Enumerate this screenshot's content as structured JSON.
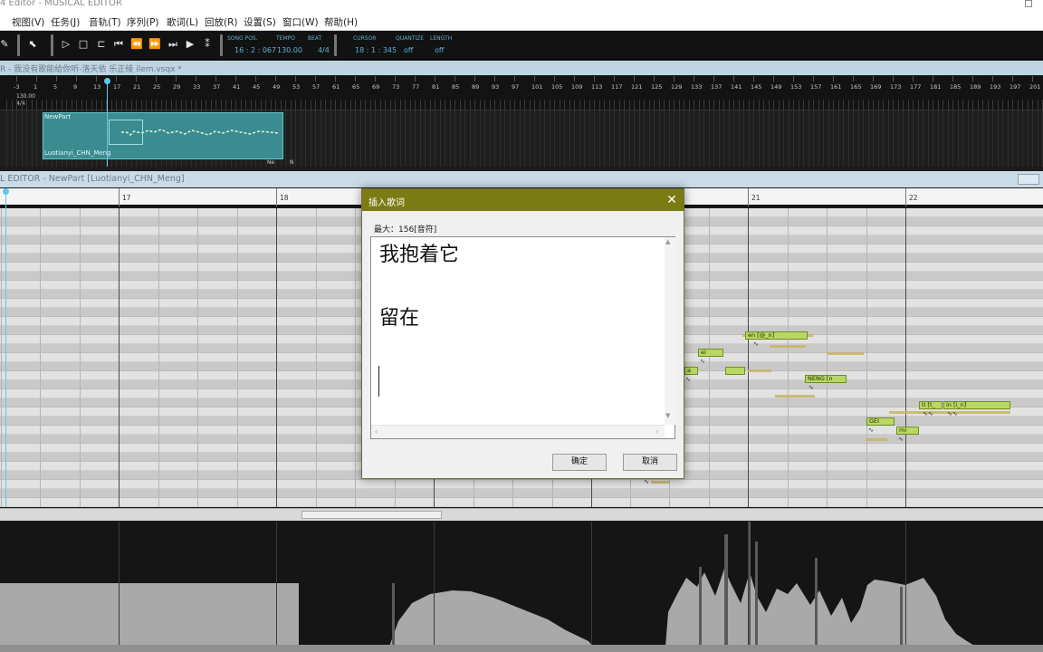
{
  "window": {
    "title": "4 Editor - MUSICAL EDITOR"
  },
  "menu": [
    {
      "label": "视图(V)"
    },
    {
      "label": "任务(J)"
    },
    {
      "label": "音轨(T)"
    },
    {
      "label": "序列(P)"
    },
    {
      "label": "歌词(L)"
    },
    {
      "label": "回放(R)"
    },
    {
      "label": "设置(S)"
    },
    {
      "label": "窗口(W)"
    },
    {
      "label": "帮助(H)"
    }
  ],
  "transport": {
    "song_pos_label": "SONG POS.",
    "song_pos_value": "16 : 2 : 067",
    "tempo_label": "TEMPO",
    "tempo_value": "130.00",
    "beat_label": "BEAT",
    "beat_value": "4/4",
    "cursor_label": "CURSOR",
    "cursor_value": "18 : 1 : 345",
    "quantize_label": "QUANTIZE",
    "quantize_value": "off",
    "length_label": "LENGTH",
    "length_value": "off"
  },
  "arrangement": {
    "file_tab": "R - 我没有歌能给你听-洛天依 乐正绫 ilem.vsqx *",
    "tempo_marker": "130.00",
    "beat_marker": "4/4",
    "ruler_labels": [
      "-3",
      "1",
      "5",
      "9",
      "13",
      "17",
      "21",
      "25",
      "29",
      "33",
      "37",
      "41",
      "45",
      "49",
      "53",
      "57",
      "61",
      "65",
      "69",
      "73",
      "77",
      "81",
      "85",
      "89",
      "93",
      "97",
      "101",
      "105",
      "109",
      "113",
      "117",
      "121",
      "125",
      "129",
      "133",
      "137",
      "141",
      "145",
      "149",
      "153",
      "157",
      "161",
      "165",
      "169",
      "173",
      "177",
      "181",
      "185",
      "189",
      "193",
      "197",
      "201"
    ],
    "part_name": "NewPart",
    "part_singer": "Luotianyi_CHN_Meng",
    "tag_ne": "Ne",
    "tag_n": "N"
  },
  "editor": {
    "tab_title": "L EDITOR - NewPart [Luotianyi_CHN_Meng]",
    "bars": [
      "17",
      "18",
      "21",
      "22"
    ],
    "notes": [
      {
        "label": "en [@_n]"
      },
      {
        "label": "ei"
      },
      {
        "label": "a"
      },
      {
        "label": ""
      },
      {
        "label": "NENG [n"
      },
      {
        "label": "ti [t_"
      },
      {
        "label": "in [i_n]"
      },
      {
        "label": "GEI"
      },
      {
        "label": "mi"
      }
    ]
  },
  "dialog": {
    "title": "插入歌词",
    "max_label": "最大：156[音符]",
    "lines": [
      "我抱着它",
      "留在"
    ],
    "ok": "确定",
    "cancel": "取消"
  }
}
